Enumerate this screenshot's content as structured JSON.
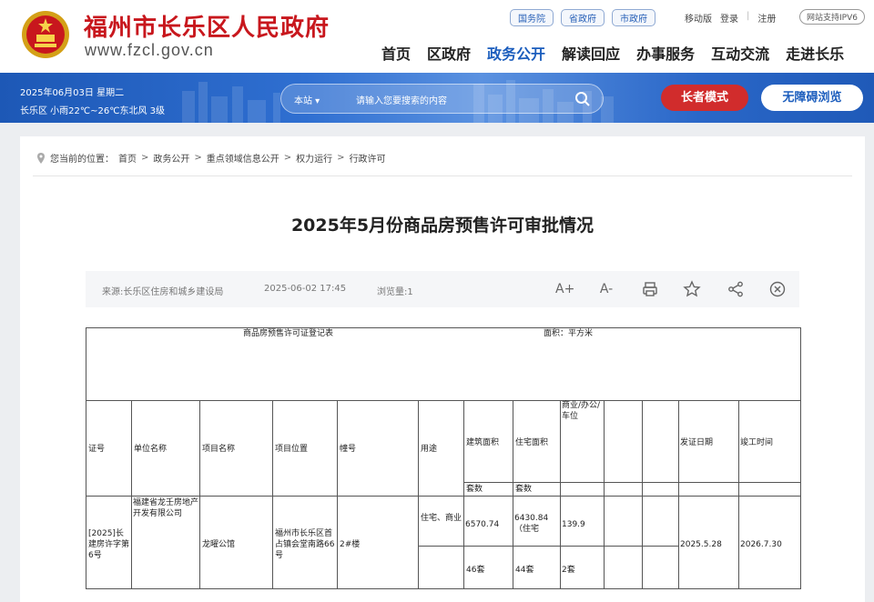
{
  "header": {
    "site_name": "福州市长乐区人民政府",
    "site_url": "www.fzcl.gov.cn",
    "link_buttons": [
      "国务院",
      "省政府",
      "市政府"
    ],
    "top_links": {
      "mobile": "移动版",
      "login": "登录",
      "register": "注册"
    },
    "ipv6": "网站支持IPV6",
    "nav": [
      "首页",
      "区政府",
      "政务公开",
      "解读回应",
      "办事服务",
      "互动交流",
      "走进长乐"
    ],
    "active_nav": "政务公开"
  },
  "banner": {
    "date": "2025年06月03日 星期二",
    "weather": "长乐区 小雨22℃~26℃东北风 3级",
    "search_scope": "本站 ▾",
    "search_placeholder": "请输入您要搜索的内容",
    "elder_mode": "长者模式",
    "accessible": "无障碍浏览"
  },
  "breadcrumb": {
    "prefix": "您当前的位置：",
    "items": [
      "首页",
      "政务公开",
      "重点领域信息公开",
      "权力运行",
      "行政许可"
    ]
  },
  "article": {
    "title": "2025年5月份商品房预售许可审批情况",
    "source": "来源:长乐区住房和城乡建设局",
    "date": "2025-06-02 17:45",
    "views": "浏览量:1",
    "tools": [
      "A+",
      "A-",
      "print-icon",
      "star-icon",
      "share-icon",
      "close-icon"
    ]
  },
  "permit_table": {
    "caption": "商品房预售许可证登记表",
    "unit": "面积：平方米",
    "headers": {
      "cert_no": "证号",
      "company": "单位名称",
      "project": "项目名称",
      "location": "项目位置",
      "building": "幢号",
      "usage": "用途",
      "build_area": "建筑面积",
      "res_area": "住宅面积",
      "biz_area": "商业/办公/车位",
      "issue_date": "发证日期",
      "completion": "竣工时间",
      "units": "套数",
      "units2": "套数"
    },
    "row": {
      "cert_no": "[2025]长建房许字第6号",
      "company": "福建省龙壬房地产开发有限公司",
      "project": "龙曜公馆",
      "location": "福州市长乐区首占镇会堂南路66号",
      "building": "2#楼",
      "usage": "住宅、商业",
      "build_area": "6570.74",
      "res_area": "6430.84（住宅",
      "biz_area": "139.9",
      "issue_date": "2025.5.28",
      "completion": "2026.7.30",
      "build_units": "46套",
      "res_units": "44套",
      "biz_units": "2套"
    }
  },
  "colors": {
    "brand_red": "#c8171d",
    "brand_blue": "#1b5dbd"
  }
}
